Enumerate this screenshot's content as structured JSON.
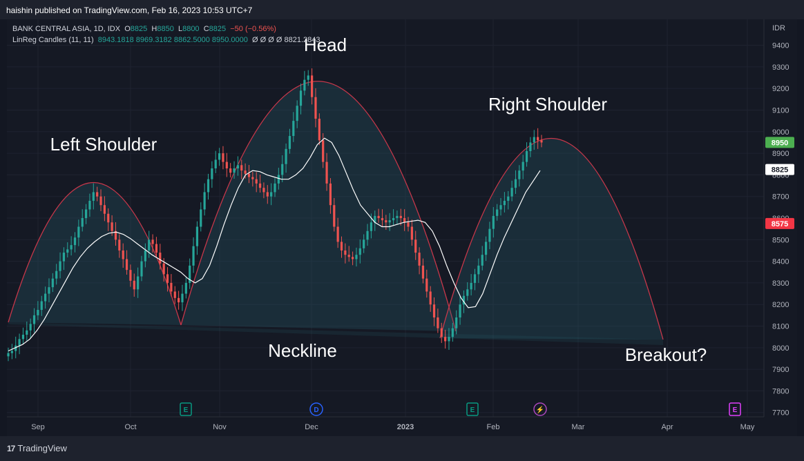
{
  "header": {
    "attribution": "haishin published on TradingView.com, Feb 16, 2023 10:53 UTC+7"
  },
  "legend": {
    "symbol": "BANK CENTRAL ASIA, 1D, IDX",
    "open_label": "O",
    "open": "8825",
    "high_label": "H",
    "high": "8850",
    "low_label": "L",
    "low": "8800",
    "close_label": "C",
    "close": "8825",
    "change": "−50 (−0.56%)",
    "indicator": "LinReg Candles (11, 11)",
    "ind_values": "8943.1818  8969.3182  8862.5000  8950.0000",
    "ind_extra": "Ø  Ø  Ø  Ø  8821.2843"
  },
  "footer": {
    "brand": "TradingView"
  },
  "chart_data": {
    "type": "candlestick",
    "currency": "IDR",
    "y_ticks": [
      7700,
      7800,
      7900,
      8000,
      8100,
      8200,
      8300,
      8400,
      8500,
      8600,
      8700,
      8800,
      8900,
      9000,
      9100,
      9200,
      9300,
      9400
    ],
    "ylim": [
      7680,
      9520
    ],
    "x_ticks": [
      "Sep",
      "Oct",
      "Nov",
      "Dec",
      "2023",
      "Feb",
      "Mar",
      "Apr",
      "May"
    ],
    "price_labels": [
      {
        "text": "8950",
        "value": 8950,
        "color": "#4caf50"
      },
      {
        "text": "8825",
        "value": 8825,
        "color": "#ffffff"
      },
      {
        "text": "8575",
        "value": 8575,
        "color": "#f23645"
      }
    ],
    "annotations": [
      "Left Shoulder",
      "Head",
      "Right Shoulder",
      "Neckline",
      "Breakout?"
    ],
    "event_markers": [
      {
        "label": "E",
        "color": "#089981"
      },
      {
        "label": "D",
        "color": "#2962ff"
      },
      {
        "label": "E",
        "color": "#089981"
      },
      {
        "label": "⚡",
        "color": "#ab47bc"
      },
      {
        "label": "E",
        "color": "#e040fb"
      }
    ],
    "series": [
      {
        "name": "BANK CENTRAL ASIA",
        "type": "candles",
        "close": [
          7975,
          7985,
          8010,
          8040,
          8060,
          8080,
          8110,
          8150,
          8175,
          8215,
          8250,
          8280,
          8320,
          8355,
          8400,
          8440,
          8455,
          8475,
          8510,
          8560,
          8600,
          8640,
          8680,
          8720,
          8700,
          8660,
          8620,
          8580,
          8540,
          8500,
          8450,
          8410,
          8360,
          8310,
          8270,
          8330,
          8400,
          8450,
          8500,
          8480,
          8440,
          8390,
          8340,
          8300,
          8260,
          8230,
          8210,
          8250,
          8300,
          8380,
          8470,
          8560,
          8640,
          8720,
          8780,
          8830,
          8870,
          8900,
          8860,
          8830,
          8810,
          8830,
          8845,
          8820,
          8805,
          8790,
          8780,
          8760,
          8740,
          8720,
          8700,
          8720,
          8760,
          8800,
          8850,
          8920,
          8980,
          9050,
          9120,
          9190,
          9240,
          9260,
          9160,
          9060,
          8960,
          8860,
          8760,
          8660,
          8560,
          8490,
          8450,
          8430,
          8420,
          8410,
          8430,
          8460,
          8500,
          8540,
          8580,
          8610,
          8600,
          8590,
          8580,
          8590,
          8600,
          8610,
          8600,
          8580,
          8560,
          8500,
          8440,
          8380,
          8320,
          8260,
          8200,
          8140,
          8090,
          8050,
          8030,
          8050,
          8090,
          8140,
          8200,
          8240,
          8270,
          8300,
          8340,
          8380,
          8430,
          8490,
          8550,
          8610,
          8640,
          8660,
          8680,
          8700,
          8740,
          8780,
          8820,
          8860,
          8910,
          8950,
          8975,
          8960,
          8950
        ]
      },
      {
        "name": "LinReg Candles (11, 11)",
        "type": "line",
        "values": [
          7985,
          8000,
          8015,
          8040,
          8080,
          8130,
          8190,
          8250,
          8310,
          8370,
          8420,
          8460,
          8490,
          8515,
          8530,
          8535,
          8525,
          8505,
          8480,
          8455,
          8430,
          8410,
          8390,
          8370,
          8350,
          8320,
          8300,
          8320,
          8380,
          8470,
          8570,
          8660,
          8740,
          8800,
          8820,
          8815,
          8800,
          8790,
          8780,
          8780,
          8800,
          8830,
          8880,
          8940,
          8970,
          8950,
          8890,
          8810,
          8730,
          8660,
          8620,
          8580,
          8560,
          8560,
          8570,
          8580,
          8585,
          8590,
          8580,
          8540,
          8470,
          8380,
          8300,
          8230,
          8185,
          8190,
          8250,
          8340,
          8430,
          8510,
          8580,
          8650,
          8720,
          8770,
          8820
        ]
      }
    ]
  }
}
